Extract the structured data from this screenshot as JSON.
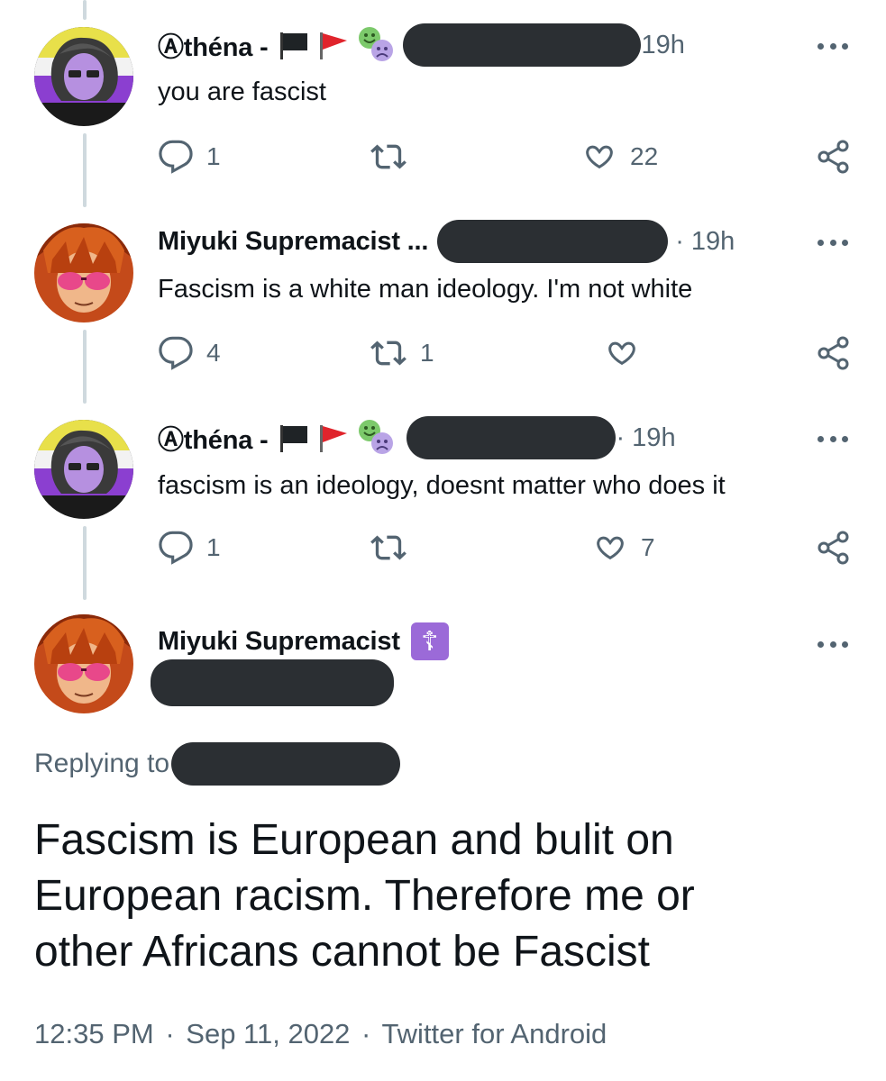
{
  "tweets": [
    {
      "name": "Ⓐthéna -",
      "time": "19h",
      "text": "you are fascist",
      "replies": "1",
      "retweets": "",
      "likes": "22"
    },
    {
      "name": "Miyuki Supremacist ...",
      "time": "· 19h",
      "text": "Fascism is a white man ideology. I'm not white",
      "replies": "4",
      "retweets": "1",
      "likes": ""
    },
    {
      "name": "Ⓐthéna -",
      "time": "· 19h",
      "text": "fascism is an ideology, doesnt matter who does it",
      "replies": "1",
      "retweets": "",
      "likes": "7"
    }
  ],
  "main_tweet": {
    "name": "Miyuki Supremacist",
    "badge": "☦",
    "replying_to_label": "Replying to",
    "text_lines": [
      "Fascism is European and bulit on",
      "European racism. Therefore me or",
      "other Africans cannot be Fascist"
    ],
    "time": "12:35 PM",
    "date": "Sep 11, 2022",
    "source": "Twitter for Android",
    "separator": "·"
  },
  "colors": {
    "text": "#0f1419",
    "secondary": "#536471",
    "thread_line": "#cfd9de",
    "redaction": "#2b2f33",
    "badge_bg": "#9b6ad8"
  },
  "icons": [
    "reply-icon",
    "retweet-icon",
    "like-icon",
    "share-icon",
    "more-icon",
    "black-flag-icon",
    "red-flag-icon",
    "theater-masks-icon",
    "orthodox-cross-icon"
  ]
}
